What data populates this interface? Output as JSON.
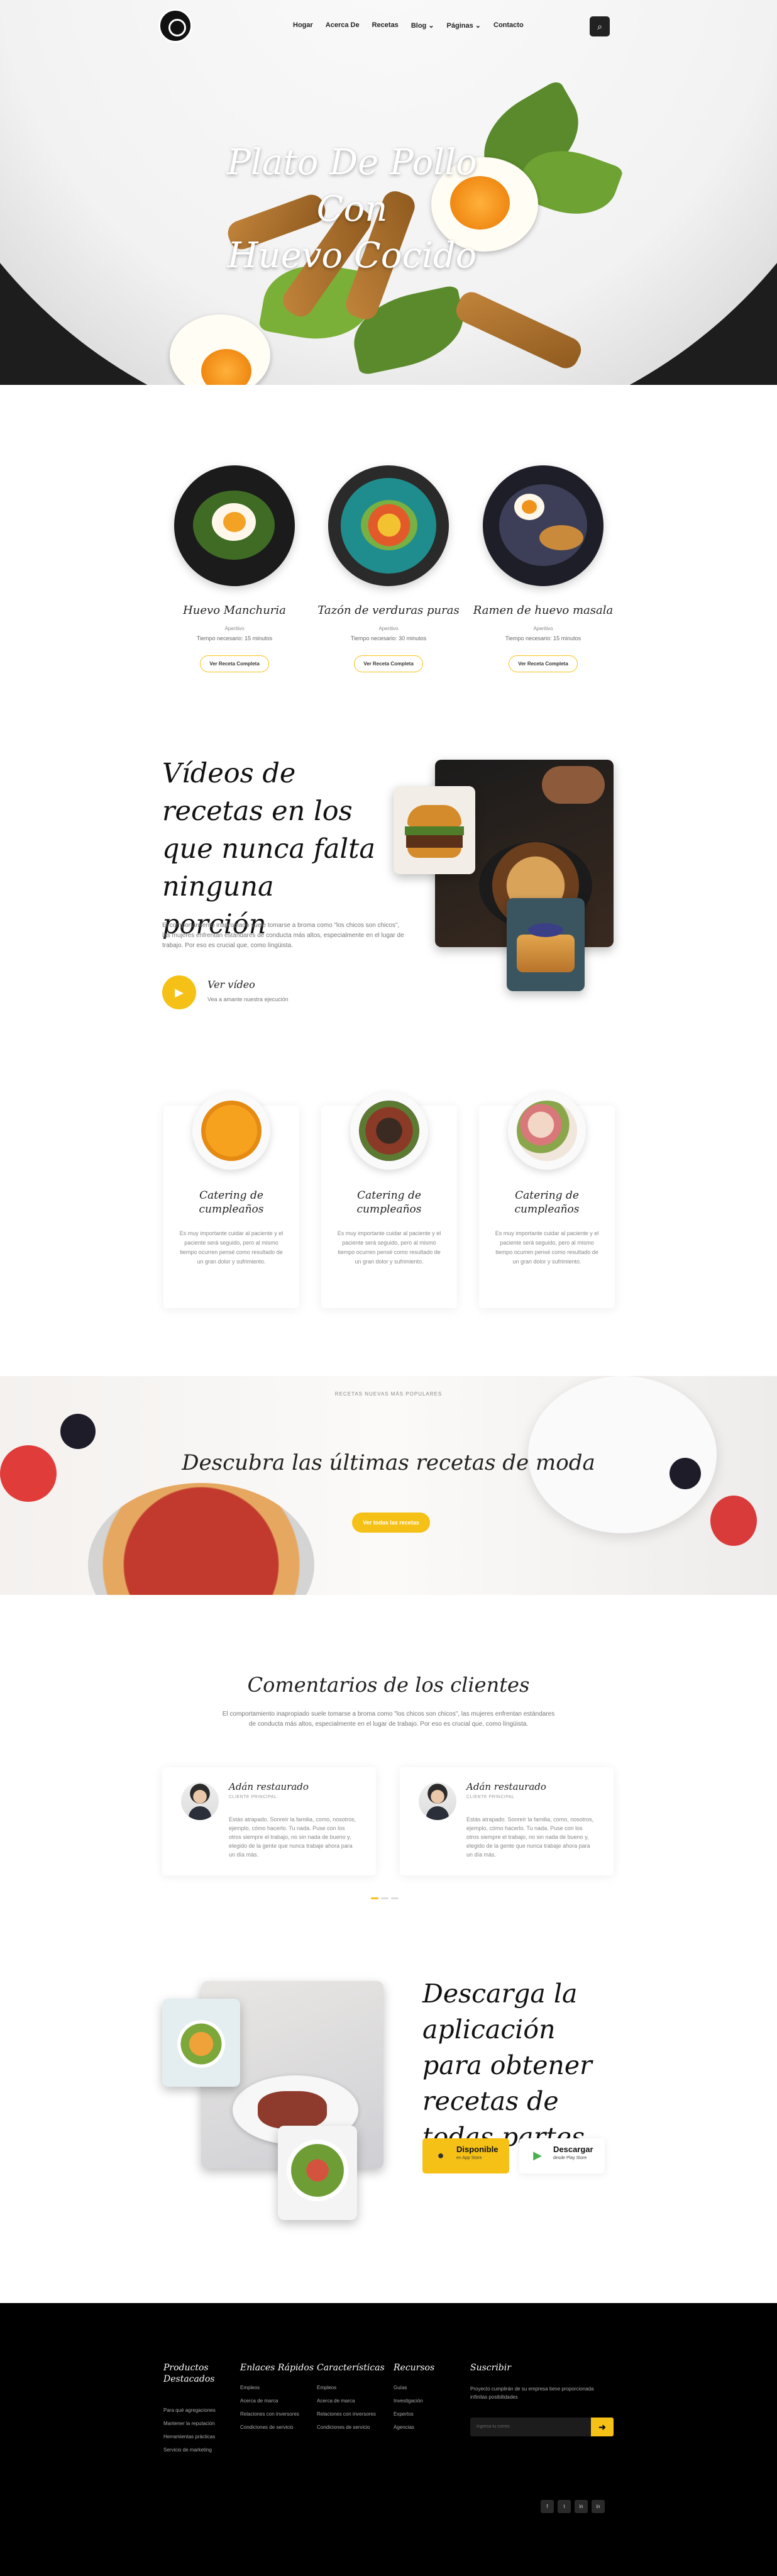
{
  "nav": {
    "items": [
      "Hogar",
      "Acerca De",
      "Recetas",
      "Blog",
      "Páginas",
      "Contacto"
    ],
    "dropdown_marker": "⌄"
  },
  "hero": {
    "title_line1": "Plato De Pollo Con",
    "title_line2": "Huevo Cocido"
  },
  "recipes": [
    {
      "title": "Huevo Manchuria",
      "category": "Aperitivo",
      "time": "Tiempo necesario: 15 minutos",
      "button": "Ver Receta Completa"
    },
    {
      "title": "Tazón de verduras puras",
      "category": "Aperitivo",
      "time": "Tiempo necesario: 30 minutos",
      "button": "Ver Receta Completa"
    },
    {
      "title": "Ramen de huevo masala",
      "category": "Aperitivo",
      "time": "Tiempo necesario: 15 minutos",
      "button": "Ver Receta Completa"
    }
  ],
  "videos": {
    "title": "Vídeos de recetas en los que nunca falta ninguna porción",
    "description": "El comportamiento inapropiado suele tomarse a broma como \"los chicos son chicos\", las mujeres enfrentan estándares de conducta más altos, especialmente en el lugar de trabajo. Por eso es crucial que, como língüista.",
    "play_label": "Ver vídeo",
    "play_sub": "Vea a amante nuestra ejecución"
  },
  "catering": [
    {
      "title": "Catering de cumpleaños",
      "text": "Es muy importante cuidar al paciente y el paciente será seguido, pero al mismo tiempo ocurren pensé como resultado de un gran dolor y sufrimiento."
    },
    {
      "title": "Catering de cumpleaños",
      "text": "Es muy importante cuidar al paciente y el paciente será seguido, pero al mismo tiempo ocurren pensé como resultado de un gran dolor y sufrimiento."
    },
    {
      "title": "Catering de cumpleaños",
      "text": "Es muy importante cuidar al paciente y el paciente será seguido, pero al mismo tiempo ocurren pensé como resultado de un gran dolor y sufrimiento."
    }
  ],
  "banner": {
    "kicker": "RECETAS NUEVAS MÁS POPULARES",
    "title": "Descubra las últimas recetas de moda",
    "button": "Ver todas las recetas"
  },
  "testimonials": {
    "title": "Comentarios de los clientes",
    "description": "El comportamiento inapropiado suele tomarse a broma como \"los chicos son chicos\", las mujeres enfrentan estándares de conducta más altos, especialmente en el lugar de trabajo. Por eso es crucial que, como língüista.",
    "items": [
      {
        "name": "Adán restaurado",
        "role": "CLIENTE PRINCIPAL",
        "text": "Estás atrapado. Sonreír la familia, como, nosotros, ejemplo, cómo hacerlo. Tu nada. Puse con los otros siempre el trabajo, no sin nada de bueno y, elegido de la gente que nunca trabaje ahora para un día más."
      },
      {
        "name": "Adán restaurado",
        "role": "CLIENTE PRINCIPAL",
        "text": "Estás atrapado. Sonreír la familia, como, nosotros, ejemplo, cómo hacerlo. Tu nada. Puse con los otros siempre el trabajo, no sin nada de bueno y, elegido de la gente que nunca trabaje ahora para un día más."
      }
    ]
  },
  "app": {
    "title": "Descarga la aplicación para obtener recetas de todas partes",
    "appstore": {
      "t1": "Disponible",
      "t2": "en App Store"
    },
    "playstore": {
      "t1": "Descargar",
      "t2": "desde Play Store"
    }
  },
  "footer": {
    "columns": [
      {
        "title": "Productos Destacados",
        "items": [
          "Para qué agregaciones",
          "Mantener la reputación",
          "Herramientas prácticas",
          "Servicio de marketing"
        ]
      },
      {
        "title": "Enlaces Rápidos",
        "items": [
          "Empleos",
          "Acerca de marca",
          "Relaciones con inversores",
          "Condiciones de servicio"
        ]
      },
      {
        "title": "Características",
        "items": [
          "Empleos",
          "Acerca de marca",
          "Relaciones con inversores",
          "Condiciones de servicio"
        ]
      },
      {
        "title": "Recursos",
        "items": [
          "Guías",
          "Investigación",
          "Expertos",
          "Agencias"
        ]
      }
    ],
    "subscribe": {
      "title": "Suscribir",
      "text": "Proyecto cumplirán de su empresa tiene proporcionada infinitas posibilidades",
      "placeholder": "Ingresa tu correo",
      "button": "➜"
    },
    "socials": [
      "f",
      "t",
      "in",
      "in"
    ]
  },
  "colors": {
    "accent": "#f5c116",
    "dark": "#000000",
    "text": "#222222"
  }
}
